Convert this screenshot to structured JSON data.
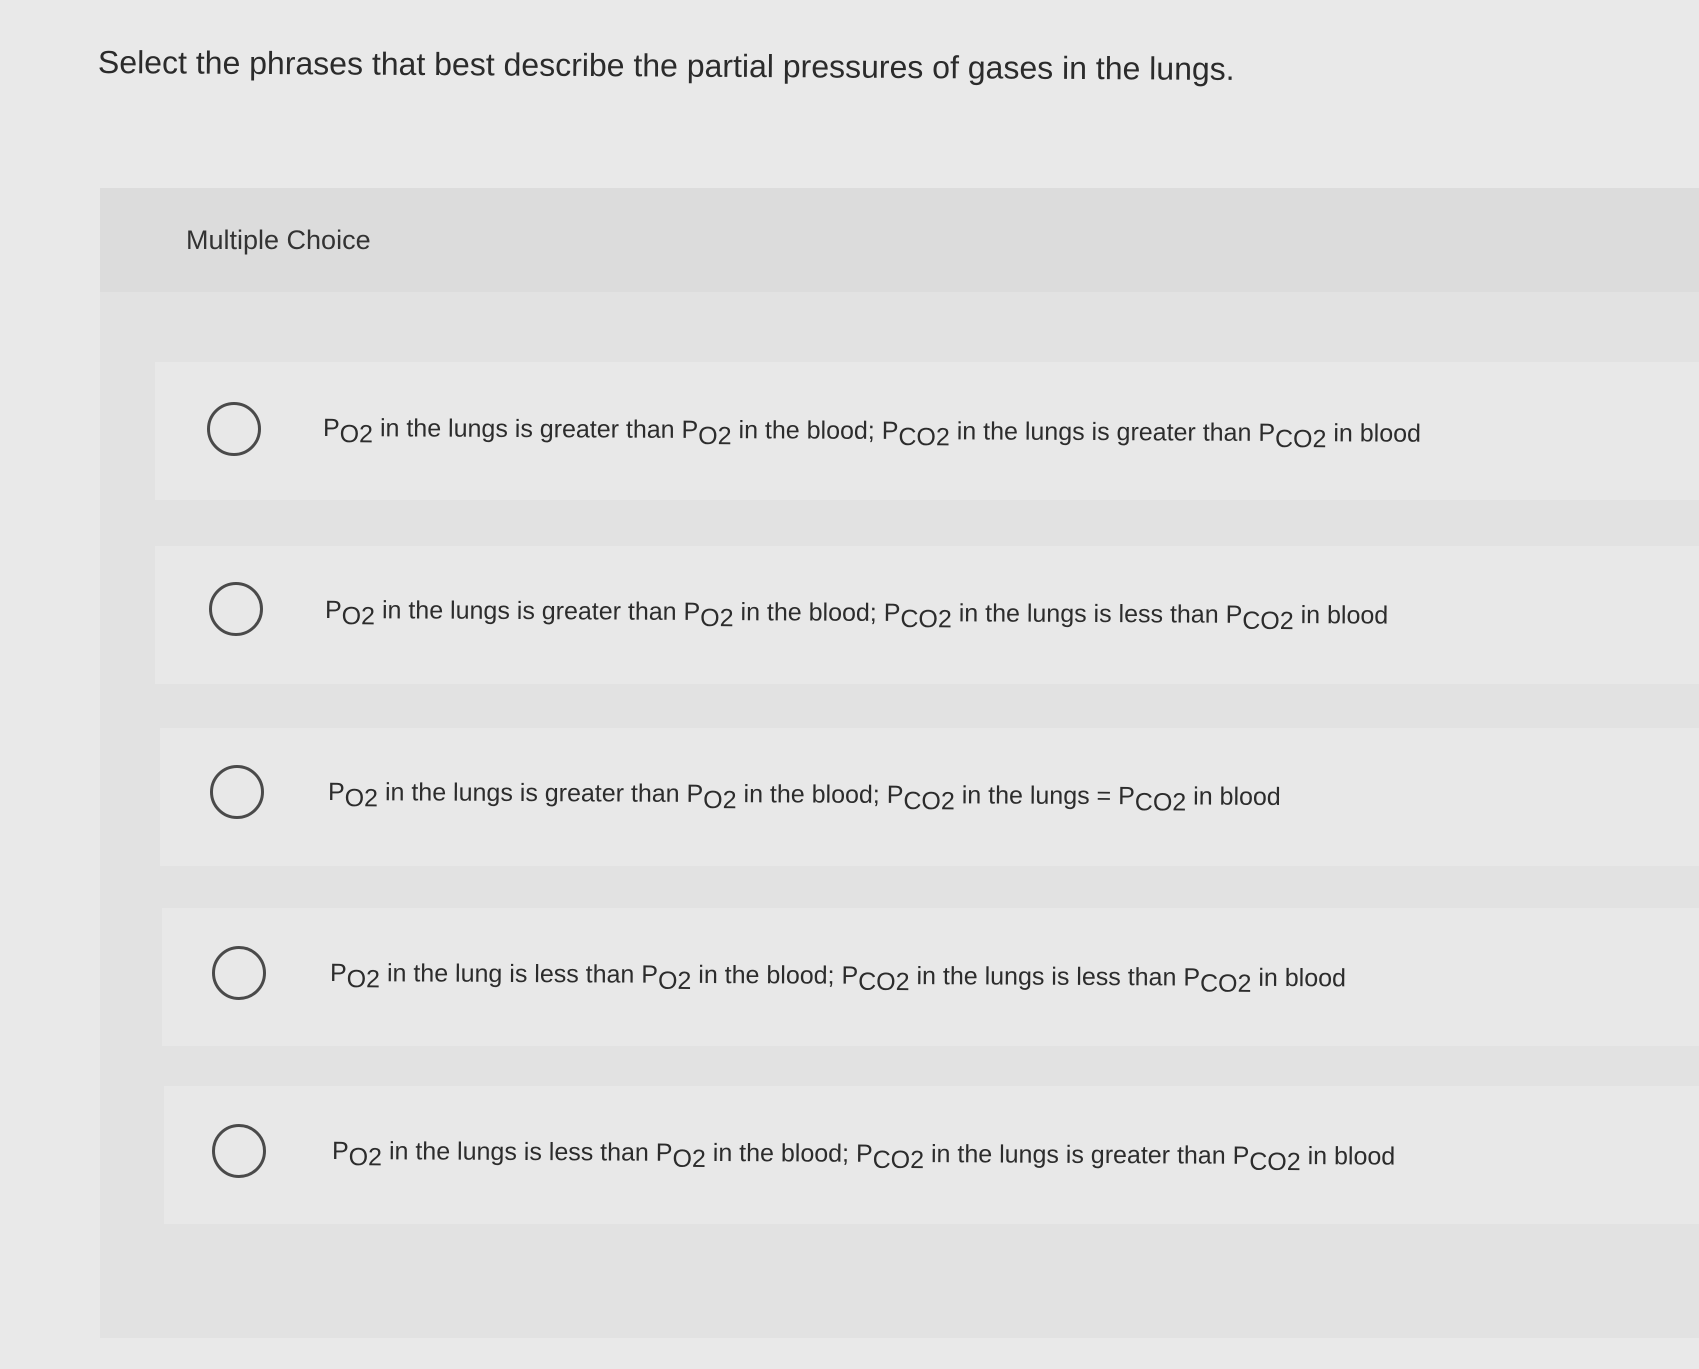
{
  "question": "Select the phrases that best describe the partial pressures of gases in the lungs.",
  "section_label": "Multiple Choice",
  "options": [
    {
      "parts": [
        {
          "k": "sym",
          "t": "P"
        },
        {
          "k": "sub",
          "t": "O2"
        },
        {
          "k": "txt",
          "t": " in the lungs is greater than "
        },
        {
          "k": "sym",
          "t": "P"
        },
        {
          "k": "sub",
          "t": "O2"
        },
        {
          "k": "txt",
          "t": " in the blood; "
        },
        {
          "k": "sym",
          "t": "P"
        },
        {
          "k": "sub",
          "t": "CO2"
        },
        {
          "k": "txt",
          "t": " in the lungs is greater than "
        },
        {
          "k": "sym",
          "t": "P"
        },
        {
          "k": "sub",
          "t": "CO2"
        },
        {
          "k": "txt",
          "t": " in blood"
        }
      ]
    },
    {
      "parts": [
        {
          "k": "sym",
          "t": "P"
        },
        {
          "k": "sub",
          "t": "O2"
        },
        {
          "k": "txt",
          "t": " in the lungs is greater than "
        },
        {
          "k": "sym",
          "t": "P"
        },
        {
          "k": "sub",
          "t": "O2"
        },
        {
          "k": "txt",
          "t": " in the blood; "
        },
        {
          "k": "sym",
          "t": "P"
        },
        {
          "k": "sub",
          "t": "CO2"
        },
        {
          "k": "txt",
          "t": " in the lungs is less than "
        },
        {
          "k": "sym",
          "t": "P"
        },
        {
          "k": "sub",
          "t": "CO2"
        },
        {
          "k": "txt",
          "t": " in blood"
        }
      ]
    },
    {
      "parts": [
        {
          "k": "sym",
          "t": "P"
        },
        {
          "k": "sub",
          "t": "O2"
        },
        {
          "k": "txt",
          "t": " in the lungs is greater than "
        },
        {
          "k": "sym",
          "t": "P"
        },
        {
          "k": "sub",
          "t": "O2"
        },
        {
          "k": "txt",
          "t": " in the blood; "
        },
        {
          "k": "sym",
          "t": "P"
        },
        {
          "k": "sub",
          "t": "CO2"
        },
        {
          "k": "txt",
          "t": " in the lungs = "
        },
        {
          "k": "sym",
          "t": "P"
        },
        {
          "k": "sub",
          "t": "CO2"
        },
        {
          "k": "txt",
          "t": " in blood"
        }
      ]
    },
    {
      "parts": [
        {
          "k": "sym",
          "t": "P"
        },
        {
          "k": "sub",
          "t": "O2"
        },
        {
          "k": "txt",
          "t": " in the lung is less than "
        },
        {
          "k": "sym",
          "t": "P"
        },
        {
          "k": "sub",
          "t": "O2"
        },
        {
          "k": "txt",
          "t": " in the blood; "
        },
        {
          "k": "sym",
          "t": "P"
        },
        {
          "k": "sub",
          "t": "CO2"
        },
        {
          "k": "txt",
          "t": " in the lungs is less than "
        },
        {
          "k": "sym",
          "t": "P"
        },
        {
          "k": "sub",
          "t": "CO2"
        },
        {
          "k": "txt",
          "t": " in blood"
        }
      ]
    },
    {
      "parts": [
        {
          "k": "sym",
          "t": "P"
        },
        {
          "k": "sub",
          "t": "O2"
        },
        {
          "k": "txt",
          "t": " in the lungs is less than "
        },
        {
          "k": "sym",
          "t": "P"
        },
        {
          "k": "sub",
          "t": "O2"
        },
        {
          "k": "txt",
          "t": " in the blood; "
        },
        {
          "k": "sym",
          "t": "P"
        },
        {
          "k": "sub",
          "t": "CO2"
        },
        {
          "k": "txt",
          "t": " in the lungs is greater than "
        },
        {
          "k": "sym",
          "t": "P"
        },
        {
          "k": "sub",
          "t": "CO2"
        },
        {
          "k": "txt",
          "t": " in blood"
        }
      ]
    }
  ]
}
